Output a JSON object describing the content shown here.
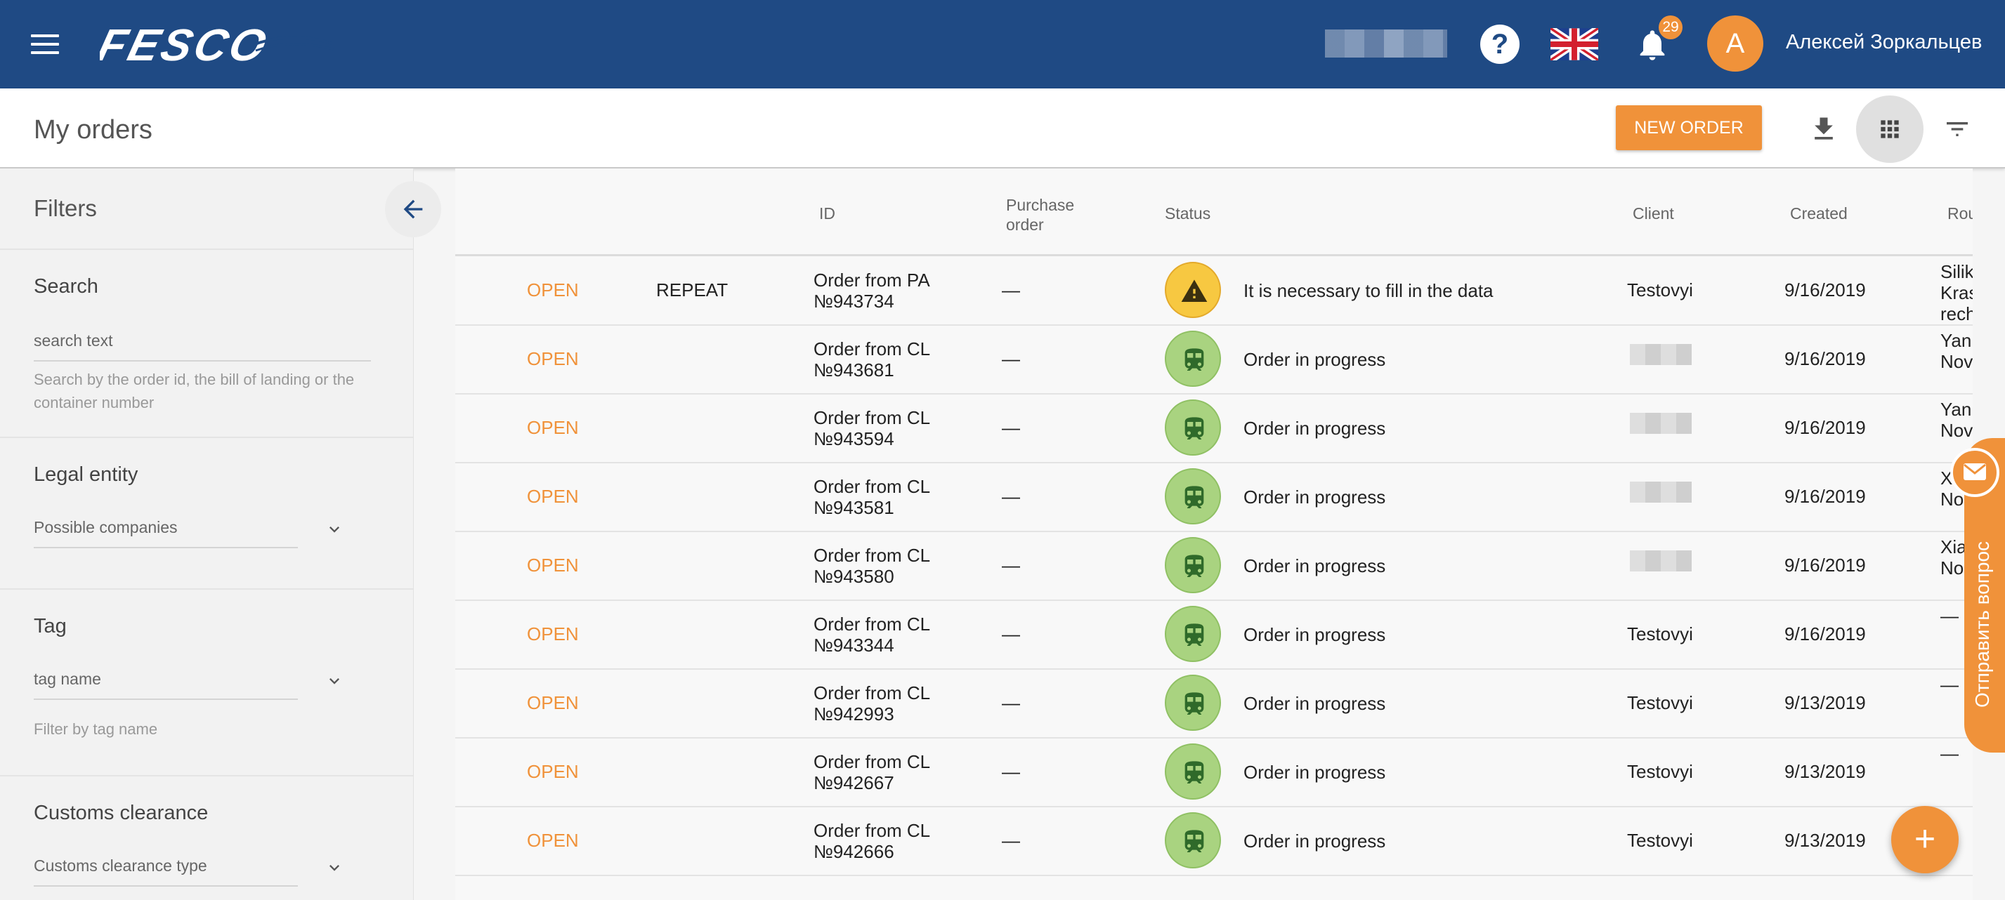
{
  "colors": {
    "header_bg": "#1f4a84",
    "accent": "#f0923a",
    "status_warning": "#f7c841",
    "status_progress": "#a9d380",
    "train_icon": "#2f6a2a"
  },
  "header": {
    "logo_text": "FESCO",
    "notification_count": "29",
    "avatar_letter": "А",
    "user_name": "Алексей Зоркальцев",
    "icons": [
      "menu-icon",
      "help-icon",
      "uk-flag-icon",
      "bell-icon"
    ]
  },
  "page": {
    "title": "My orders",
    "new_order_label": "NEW ORDER",
    "icons": [
      "download-icon",
      "grid-view-icon",
      "filter-icon"
    ]
  },
  "sidebar": {
    "title": "Filters",
    "search": {
      "title": "Search",
      "placeholder": "search text",
      "hint": "Search by the order id, the bill of landing or the container number"
    },
    "legal_entity": {
      "title": "Legal entity",
      "placeholder": "Possible companies"
    },
    "tag": {
      "title": "Tag",
      "placeholder": "tag name",
      "hint": "Filter by tag name"
    },
    "customs": {
      "title": "Customs clearance",
      "placeholder": "Customs clearance type"
    }
  },
  "table": {
    "columns": {
      "id": "ID",
      "purchase_order": "Purchase order",
      "status": "Status",
      "client": "Client",
      "created": "Created",
      "route": "Rou"
    },
    "rows": [
      {
        "state": "OPEN",
        "action": "REPEAT",
        "id_line1": "Order from PA",
        "id_line2": "№943734",
        "po": "—",
        "status_icon": "warning-icon",
        "status": "It is necessary to fill in the data",
        "client": "Testovyi",
        "created": "9/16/2019",
        "route": [
          "Silik",
          "Kras",
          "rech"
        ]
      },
      {
        "state": "OPEN",
        "action": "",
        "id_line1": "Order from CL",
        "id_line2": "№943681",
        "po": "—",
        "status_icon": "train-icon",
        "status": "Order in progress",
        "client": "",
        "created": "9/16/2019",
        "route": [
          "Yan",
          "Nov"
        ]
      },
      {
        "state": "OPEN",
        "action": "",
        "id_line1": "Order from CL",
        "id_line2": "№943594",
        "po": "—",
        "status_icon": "train-icon",
        "status": "Order in progress",
        "client": "",
        "created": "9/16/2019",
        "route": [
          "Yan",
          "Nov"
        ]
      },
      {
        "state": "OPEN",
        "action": "",
        "id_line1": "Order from CL",
        "id_line2": "№943581",
        "po": "—",
        "status_icon": "train-icon",
        "status": "Order in progress",
        "client": "",
        "created": "9/16/2019",
        "route": [
          "Xi",
          "No"
        ]
      },
      {
        "state": "OPEN",
        "action": "",
        "id_line1": "Order from CL",
        "id_line2": "№943580",
        "po": "—",
        "status_icon": "train-icon",
        "status": "Order in progress",
        "client": "",
        "created": "9/16/2019",
        "route": [
          "Xia",
          "No"
        ]
      },
      {
        "state": "OPEN",
        "action": "",
        "id_line1": "Order from CL",
        "id_line2": "№943344",
        "po": "—",
        "status_icon": "train-icon",
        "status": "Order in progress",
        "client": "Testovyi",
        "created": "9/16/2019",
        "route": [
          "—"
        ]
      },
      {
        "state": "OPEN",
        "action": "",
        "id_line1": "Order from CL",
        "id_line2": "№942993",
        "po": "—",
        "status_icon": "train-icon",
        "status": "Order in progress",
        "client": "Testovyi",
        "created": "9/13/2019",
        "route": [
          "—"
        ]
      },
      {
        "state": "OPEN",
        "action": "",
        "id_line1": "Order from CL",
        "id_line2": "№942667",
        "po": "—",
        "status_icon": "train-icon",
        "status": "Order in progress",
        "client": "Testovyi",
        "created": "9/13/2019",
        "route": [
          "—"
        ]
      },
      {
        "state": "OPEN",
        "action": "",
        "id_line1": "Order from CL",
        "id_line2": "№942666",
        "po": "—",
        "status_icon": "train-icon",
        "status": "Order in progress",
        "client": "Testovyi",
        "created": "9/13/2019",
        "route": []
      }
    ]
  },
  "feedback": {
    "label": "Отправить вопрос",
    "icon": "mail-icon"
  },
  "fab": {
    "label": "+",
    "icon": "add-icon"
  }
}
